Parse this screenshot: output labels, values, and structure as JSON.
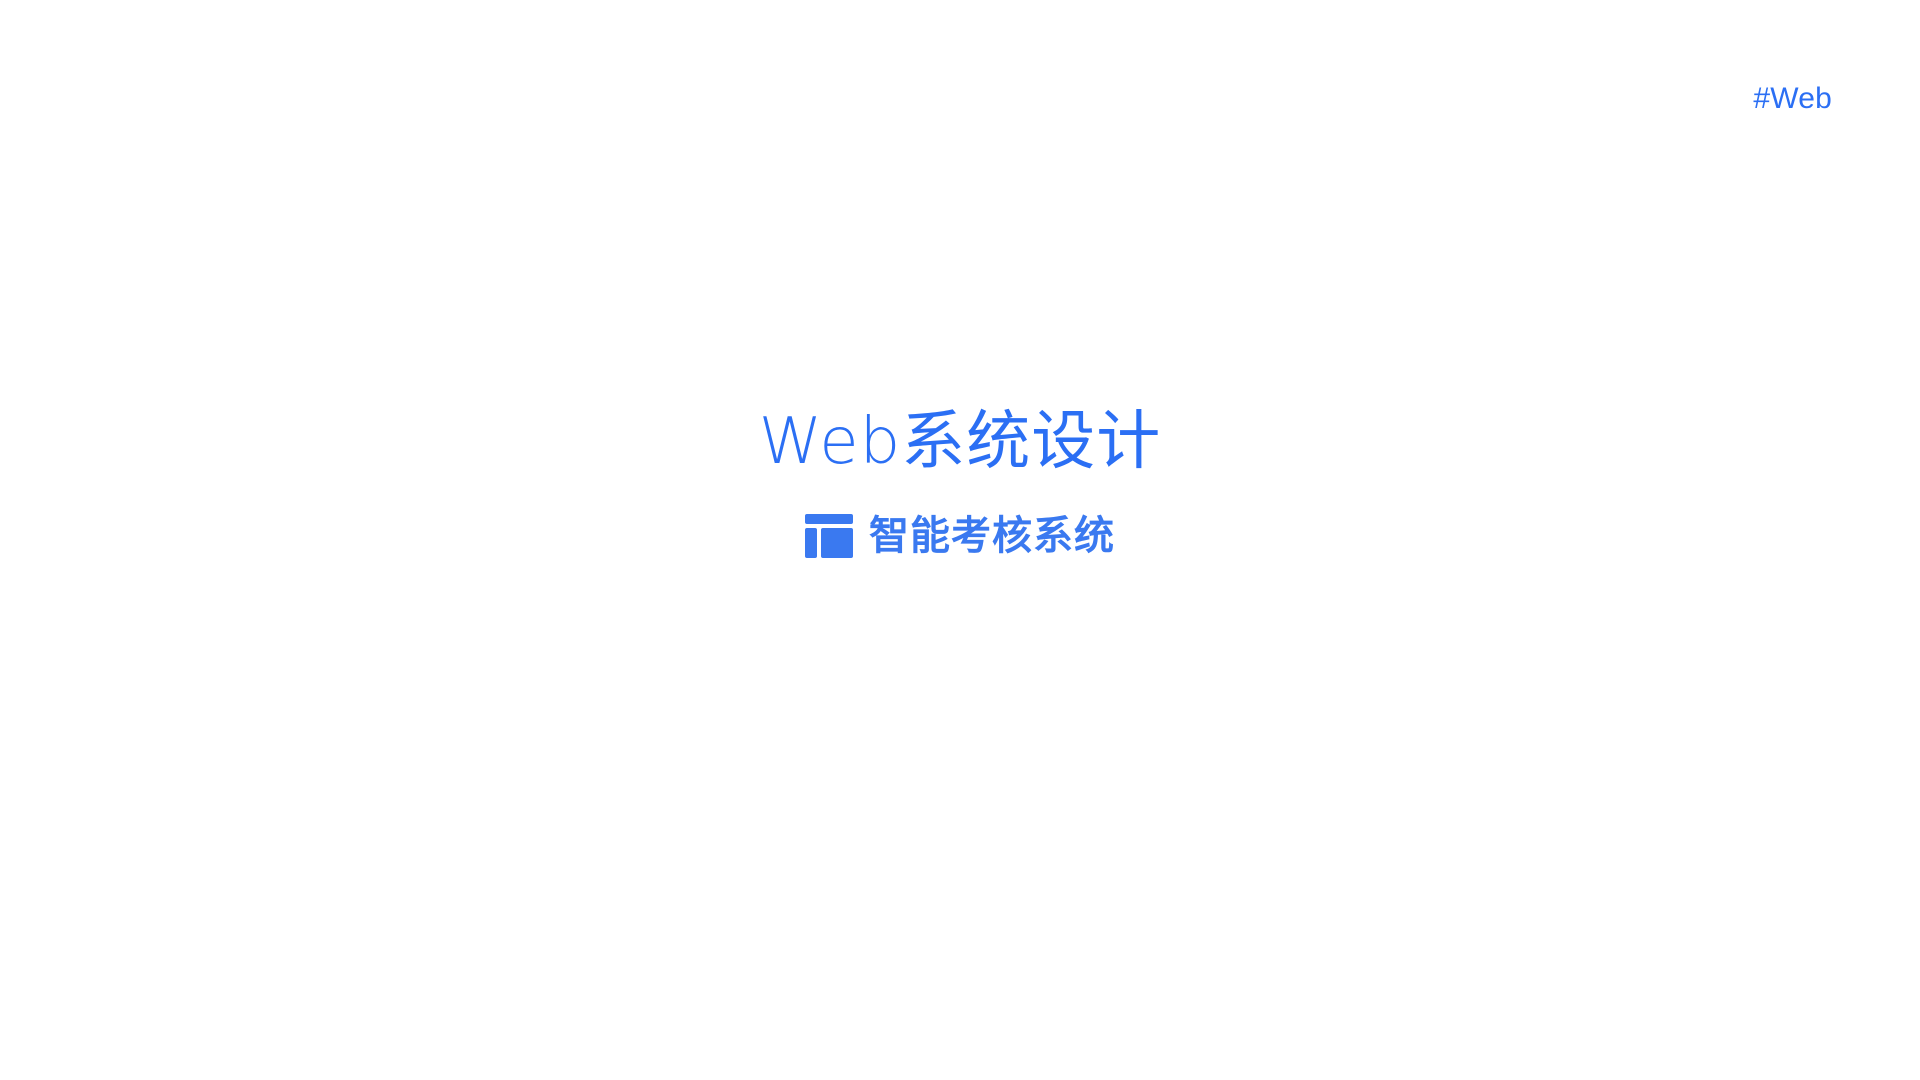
{
  "tag": "#Web",
  "title": "Web系统设计",
  "subtitle": {
    "icon": "layout-template-icon",
    "label": "智能考核系统"
  },
  "colors": {
    "accent": "#2b6ff4",
    "icon": "#3a79f0",
    "background": "#ffffff"
  }
}
